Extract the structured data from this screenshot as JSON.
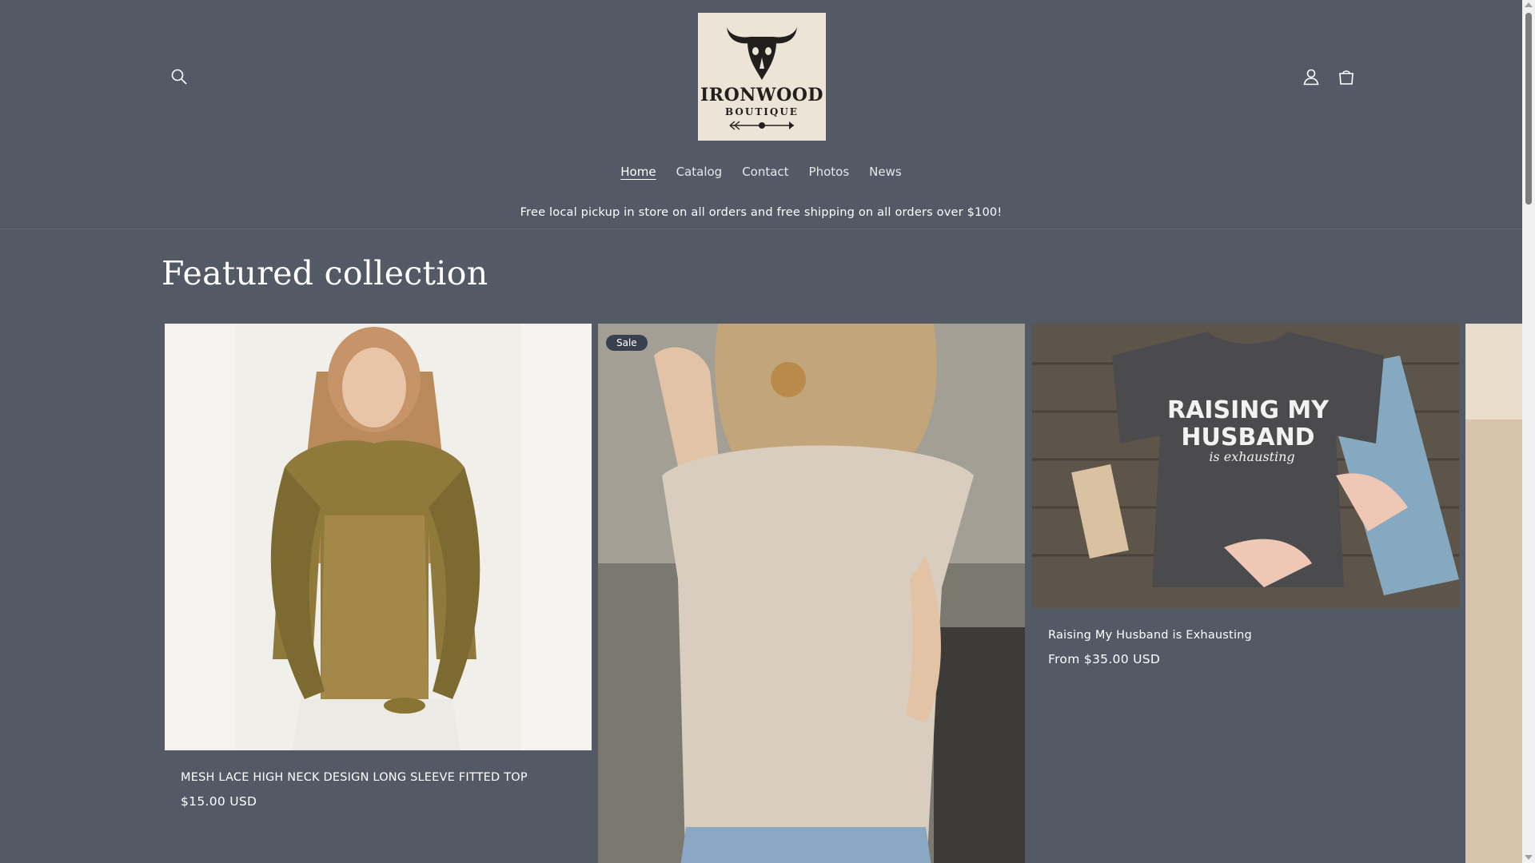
{
  "header": {
    "search_icon": "search-icon",
    "account_icon": "account-icon",
    "cart_icon": "cart-icon",
    "logo": {
      "line1": "IRONWOOD",
      "line2": "BOUTIQUE"
    }
  },
  "nav": [
    {
      "label": "Home",
      "active": true
    },
    {
      "label": "Catalog",
      "active": false
    },
    {
      "label": "Contact",
      "active": false
    },
    {
      "label": "Photos",
      "active": false
    },
    {
      "label": "News",
      "active": false
    }
  ],
  "announcement": "Free local pickup in store on all orders and free shipping on all orders over $100!",
  "section_title": "Featured collection",
  "products": [
    {
      "title": "MESH LACE HIGH NECK DESIGN LONG SLEEVE FITTED TOP",
      "price": "$15.00 USD"
    },
    {
      "badge": "Sale"
    },
    {
      "title": "Raising My Husband is Exhausting",
      "price": "From $35.00 USD",
      "shirt_text_1": "RAISING MY",
      "shirt_text_2": "HUSBAND",
      "shirt_text_3": "is exhausting"
    }
  ],
  "colors": {
    "background": "#545966",
    "badge": "#3b4050"
  }
}
